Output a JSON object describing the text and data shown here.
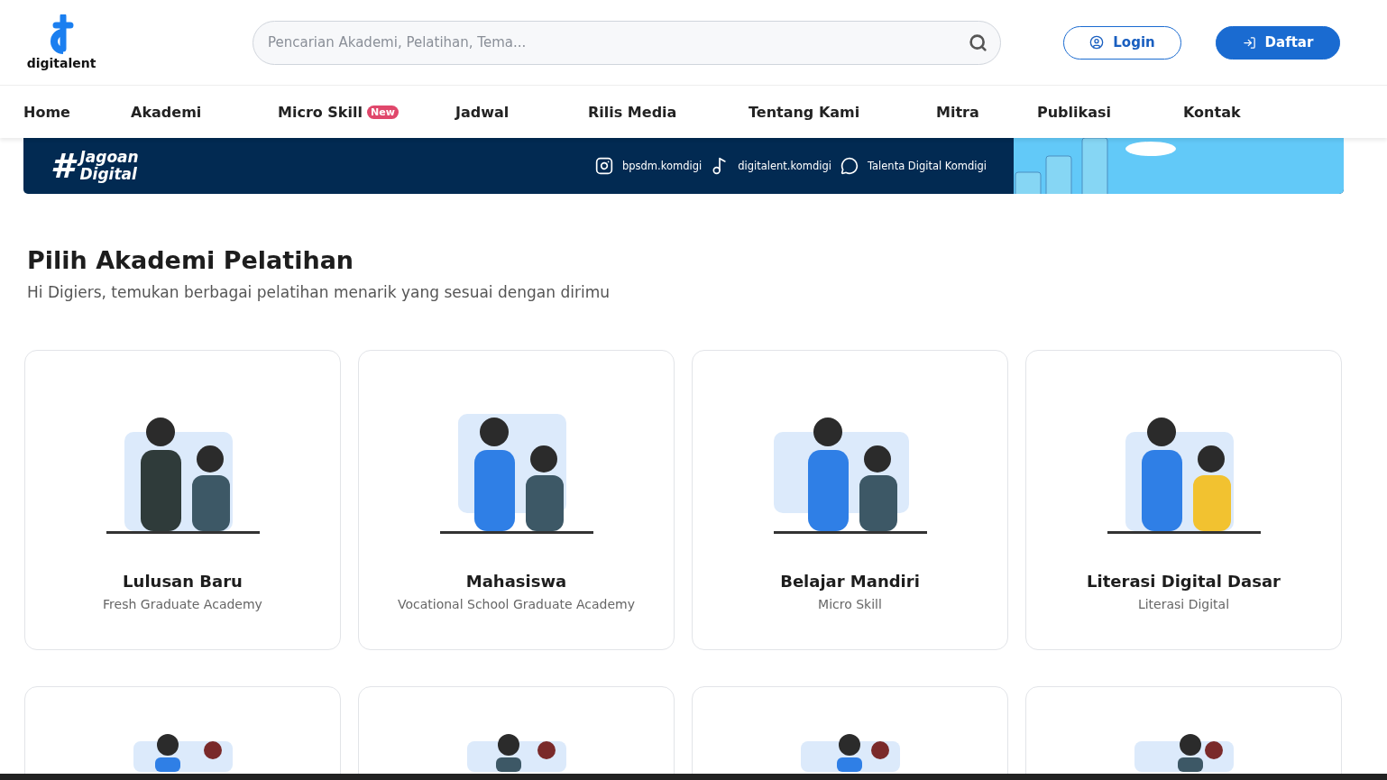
{
  "header": {
    "logo": "digitalent",
    "search": {
      "placeholder": "Pencarian Akademi, Pelatihan, Tema..."
    },
    "buttons": [
      {
        "kind": "outline",
        "label": "Login"
      },
      {
        "kind": "solid",
        "label": "Daftar"
      }
    ]
  },
  "nav": [
    {
      "label": "Home"
    },
    {
      "label": "Akademi"
    },
    {
      "label": "Micro Skill",
      "badge": "New"
    },
    {
      "label": "Jadwal"
    },
    {
      "label": "Rilis Media"
    },
    {
      "label": "Tentang Kami"
    },
    {
      "label": "Mitra"
    },
    {
      "label": "Publikasi"
    },
    {
      "label": "Kontak"
    }
  ],
  "banner": {
    "hashtag": "#",
    "tagline": "Jagoan Digital",
    "socials": [
      {
        "kind": "instagram",
        "handle": "bpsdm.komdigi"
      },
      {
        "kind": "tiktok",
        "handle": "digitalent.komdigi"
      },
      {
        "kind": "whatsapp",
        "handle": "Talenta Digital Komdigi"
      }
    ]
  },
  "section": {
    "title": "Pilih Akademi Pelatihan",
    "subtitle": "Hi Digiers, temukan berbagai pelatihan menarik yang sesuai dengan dirimu"
  },
  "cards": [
    {
      "title": "Lulusan Baru",
      "subtitle": "Fresh Graduate Academy"
    },
    {
      "title": "Mahasiswa",
      "subtitle": "Vocational School Graduate Academy"
    },
    {
      "title": "Belajar Mandiri",
      "subtitle": "Micro Skill"
    },
    {
      "title": "Literasi Digital Dasar",
      "subtitle": "Literasi Digital"
    }
  ]
}
